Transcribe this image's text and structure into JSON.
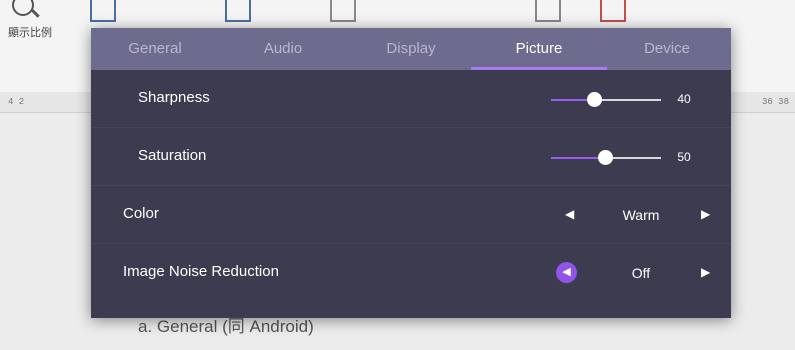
{
  "background": {
    "zoom_label": "顯示比例",
    "ruler_left": "4   2",
    "ruler_right": "36   38",
    "body_text": "a. General (同 Android)"
  },
  "tabs": [
    {
      "label": "General",
      "active": false
    },
    {
      "label": "Audio",
      "active": false
    },
    {
      "label": "Display",
      "active": false
    },
    {
      "label": "Picture",
      "active": true
    },
    {
      "label": "Device",
      "active": false
    }
  ],
  "settings": {
    "sharpness": {
      "label": "Sharpness",
      "value": "40",
      "level": 40
    },
    "saturation": {
      "label": "Saturation",
      "value": "50",
      "level": 50
    },
    "color": {
      "label": "Color",
      "value": "Warm"
    },
    "noise_reduction": {
      "label": "Image Noise Reduction",
      "value": "Off"
    }
  },
  "icons": {
    "prev": "◀",
    "next": "▶"
  },
  "colors": {
    "tab_bar": "#6e6c8e",
    "panel": "#3d3b4f",
    "accent": "#9b5cf0",
    "active_underline": "#a77cf0"
  }
}
